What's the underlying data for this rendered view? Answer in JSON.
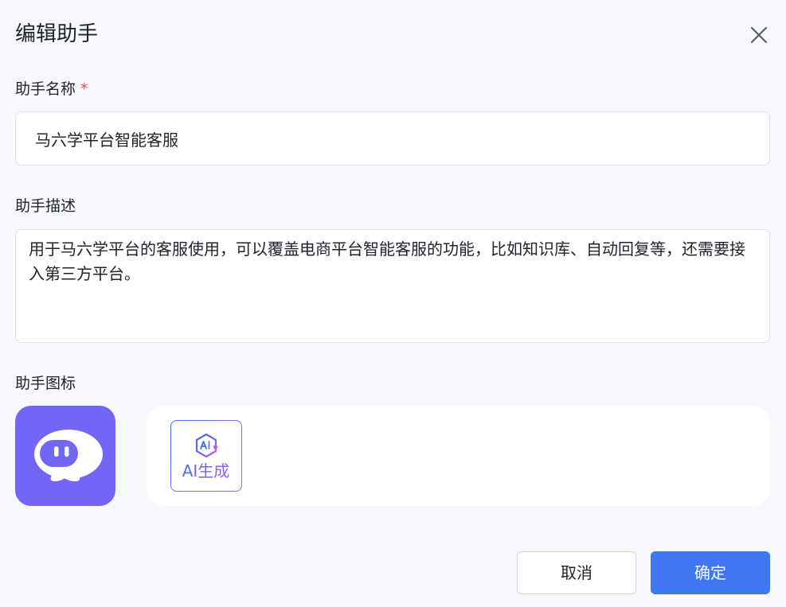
{
  "dialog": {
    "title": "编辑助手",
    "close_icon": "close-icon"
  },
  "form": {
    "name": {
      "label": "助手名称",
      "required_mark": "*",
      "value": "马六学平台智能客服"
    },
    "description": {
      "label": "助手描述",
      "value": "用于马六学平台的客服使用，可以覆盖电商平台智能客服的功能，比如知识库、自动回复等，还需要接入第三方平台。"
    },
    "icon": {
      "label": "助手图标",
      "current_icon": "robot-avatar-icon",
      "ai_generate_label": "AI生成",
      "ai_generate_icon": "ai-badge-icon"
    }
  },
  "footer": {
    "cancel_label": "取消",
    "confirm_label": "确定"
  },
  "colors": {
    "accent": "#3f77f2",
    "avatar_bg": "#7166f8",
    "required": "#f54a45",
    "ai_gradient_start": "#3b6cf2",
    "ai_gradient_end": "#b35ee8"
  }
}
